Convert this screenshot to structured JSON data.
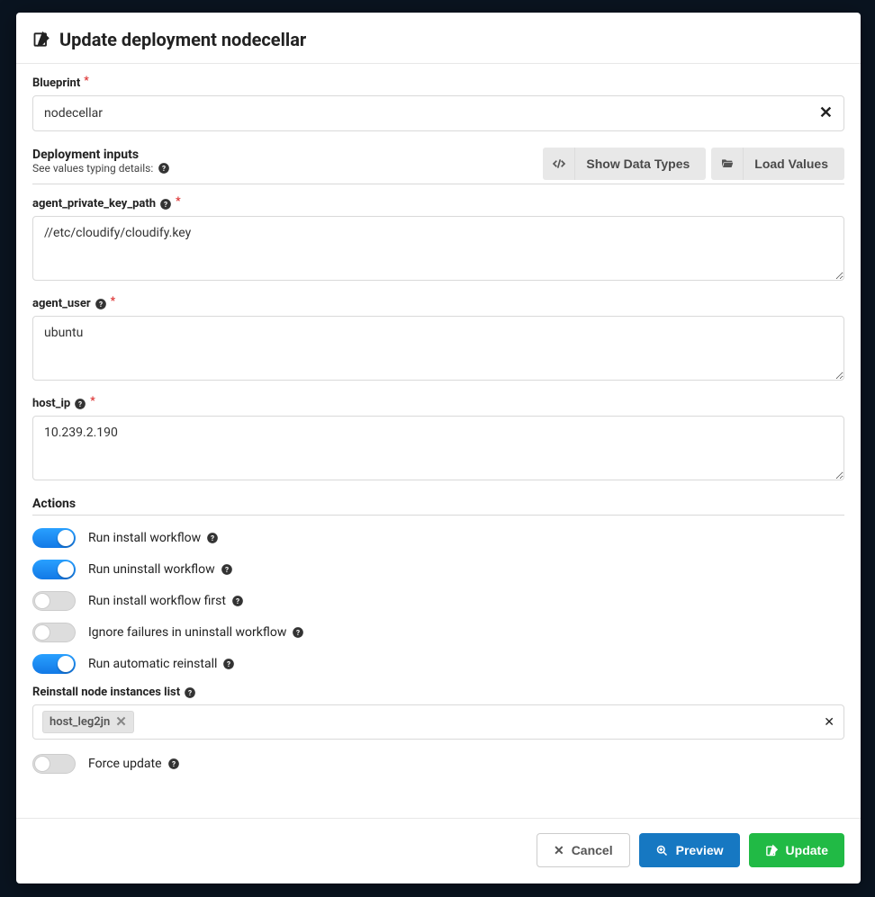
{
  "modal": {
    "title": "Update deployment nodecellar"
  },
  "blueprint": {
    "label": "Blueprint",
    "value": "nodecellar"
  },
  "inputs_section": {
    "title": "Deployment inputs",
    "sub": "See values typing details:",
    "show_data_types": "Show Data Types",
    "load_values": "Load Values"
  },
  "inputs": {
    "agent_private_key_path": {
      "label": "agent_private_key_path",
      "value": "//etc/cloudify/cloudify.key"
    },
    "agent_user": {
      "label": "agent_user",
      "value": "ubuntu"
    },
    "host_ip": {
      "label": "host_ip",
      "value": "10.239.2.190"
    }
  },
  "actions": {
    "header": "Actions",
    "run_install": "Run install workflow",
    "run_uninstall": "Run uninstall workflow",
    "install_first": "Run install workflow first",
    "ignore_failures": "Ignore failures in uninstall workflow",
    "auto_reinstall": "Run automatic reinstall",
    "reinstall_list_label": "Reinstall node instances list",
    "reinstall_chip": "host_leg2jn",
    "force_update": "Force update"
  },
  "buttons": {
    "cancel": "Cancel",
    "preview": "Preview",
    "update": "Update"
  }
}
